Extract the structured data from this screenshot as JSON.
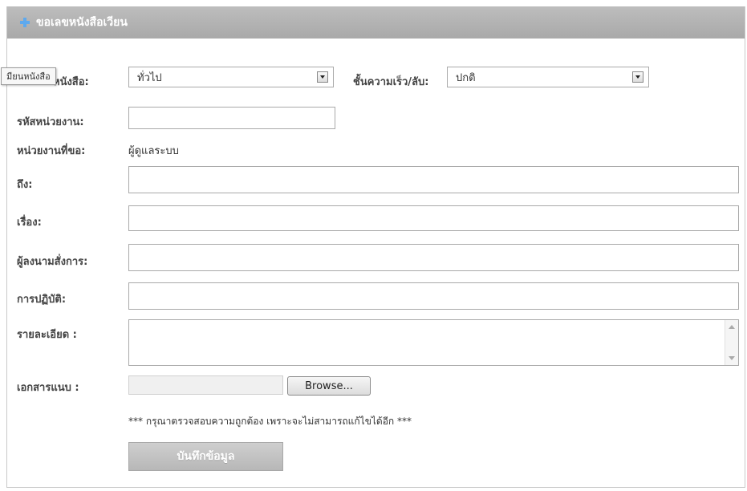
{
  "header": {
    "title": "ขอเลขหนังสือเวียน",
    "icon": "plus-icon"
  },
  "tooltip": "มียนหนังสือ",
  "form": {
    "doc_type": {
      "label": "หนังสือ:",
      "value": "ทั่วไป"
    },
    "priority": {
      "label": "ชั้นความเร็ว/ลับ:",
      "value": "ปกติ"
    },
    "unit_code": {
      "label": "รหัสหน่วยงาน:",
      "value": ""
    },
    "requester": {
      "label": "หน่วยงานที่ขอ:",
      "value": "ผู้ดูแลระบบ"
    },
    "to": {
      "label": "ถึง:",
      "value": ""
    },
    "subject": {
      "label": "เรื่อง:",
      "value": ""
    },
    "signer": {
      "label": "ผู้ลงนามสั่งการ:",
      "value": ""
    },
    "action": {
      "label": "การปฏิบัติ:",
      "value": ""
    },
    "details": {
      "label": "รายละเอียด :",
      "value": ""
    },
    "attachment": {
      "label": "เอกสารแนบ :",
      "browse_label": "Browse..."
    },
    "warning": "*** กรุณาตรวจสอบความถูกต้อง เพราะจะไม่สามารถแก้ไขได้อีก ***",
    "save_label": "บันทึกข้อมูล"
  },
  "colors": {
    "header_bg": "#b3b3b3",
    "accent": "#5ea9ee"
  }
}
